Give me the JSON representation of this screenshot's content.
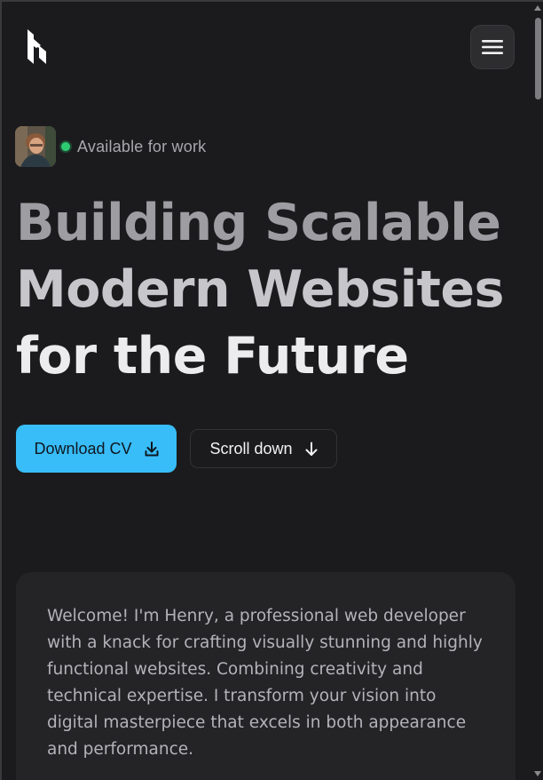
{
  "header": {
    "logo_icon": "h-logo-icon",
    "menu_icon": "hamburger-menu-icon"
  },
  "availability": {
    "avatar_icon": "profile-photo",
    "status_color": "#2ecc71",
    "text": "Available for work"
  },
  "hero": {
    "headline_line1": "Building Scalable",
    "headline_line2": "Modern Websites",
    "headline_line3": "for the Future"
  },
  "actions": {
    "download_label": "Download CV",
    "download_icon": "download-icon",
    "scroll_label": "Scroll down",
    "scroll_icon": "arrow-down-icon"
  },
  "intro": {
    "text": "Welcome! I'm Henry, a professional web developer with a knack for crafting visually stunning and highly functional websites. Combining creativity and technical expertise. I transform your vision into digital masterpiece that excels in both appearance and performance."
  },
  "colors": {
    "background": "#1b1b1d",
    "accent": "#38bdf8",
    "card": "#242427"
  }
}
